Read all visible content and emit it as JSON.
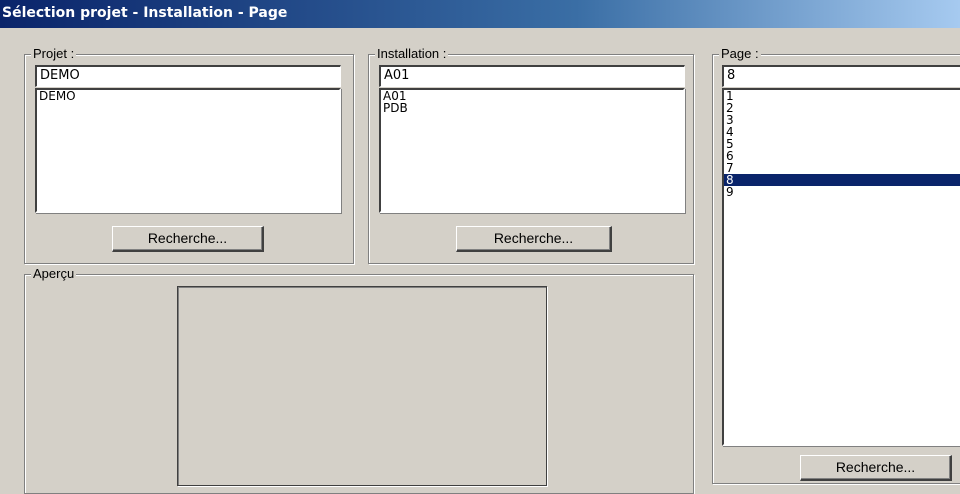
{
  "window": {
    "title": "Sélection projet - Installation - Page"
  },
  "projet": {
    "label": "Projet :",
    "value": "DEMO",
    "items": [
      "DEMO"
    ],
    "search_button": "Recherche..."
  },
  "installation": {
    "label": "Installation :",
    "value": "A01",
    "items": [
      "A01",
      "PDB"
    ],
    "search_button": "Recherche..."
  },
  "page": {
    "label": "Page :",
    "value": "8",
    "items": [
      "1",
      "2",
      "3",
      "4",
      "5",
      "6",
      "7",
      "8",
      "9"
    ],
    "selected": "8",
    "search_button": "Recherche..."
  },
  "apercu": {
    "label": "Aperçu"
  },
  "colors": {
    "selection": "#0a246a",
    "window_bg": "#d4d0c8"
  }
}
